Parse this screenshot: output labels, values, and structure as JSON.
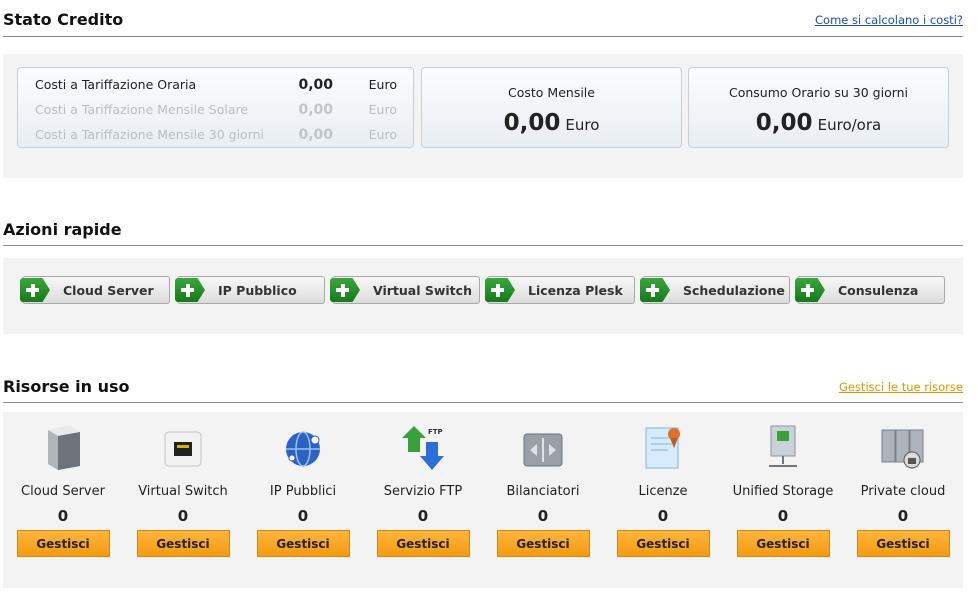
{
  "credit": {
    "title": "Stato Credito",
    "link": "Come si calcolano i costi?",
    "rows": [
      {
        "label": "Costi a Tariffazione Oraria",
        "value": "0,00",
        "currency": "Euro"
      },
      {
        "label": "Costi a Tariffazione Mensile Solare",
        "value": "0,00",
        "currency": "Euro"
      },
      {
        "label": "Costi a Tariffazione Mensile 30 giorni",
        "value": "0,00",
        "currency": "Euro"
      }
    ],
    "monthly": {
      "label": "Costo Mensile",
      "value": "0,00",
      "unit": "Euro"
    },
    "hourly": {
      "label": "Consumo Orario su 30 giorni",
      "value": "0,00",
      "unit": "Euro/ora"
    }
  },
  "quick": {
    "title": "Azioni rapide",
    "buttons": [
      "Cloud Server",
      "IP Pubblico",
      "Virtual Switch",
      "Licenza Plesk",
      "Schedulazione",
      "Consulenza"
    ]
  },
  "resources": {
    "title": "Risorse in uso",
    "link": "Gestisci le tue risorse",
    "button_label": "Gestisci",
    "items": [
      {
        "label": "Cloud Server",
        "count": "0",
        "icon": "server-icon"
      },
      {
        "label": "Virtual Switch",
        "count": "0",
        "icon": "switch-icon"
      },
      {
        "label": "IP Pubblici",
        "count": "0",
        "icon": "globe-icon"
      },
      {
        "label": "Servizio FTP",
        "count": "0",
        "icon": "ftp-icon"
      },
      {
        "label": "Bilanciatori",
        "count": "0",
        "icon": "balancer-icon"
      },
      {
        "label": "Licenze",
        "count": "0",
        "icon": "certificate-icon"
      },
      {
        "label": "Unified Storage",
        "count": "0",
        "icon": "storage-icon"
      },
      {
        "label": "Private cloud",
        "count": "0",
        "icon": "private-cloud-icon"
      }
    ]
  },
  "colors": {
    "link_blue": "#1a4fb5",
    "link_orange": "#e39400",
    "action_orange": "#f5a623",
    "plus_green": "#2a9a2e"
  }
}
